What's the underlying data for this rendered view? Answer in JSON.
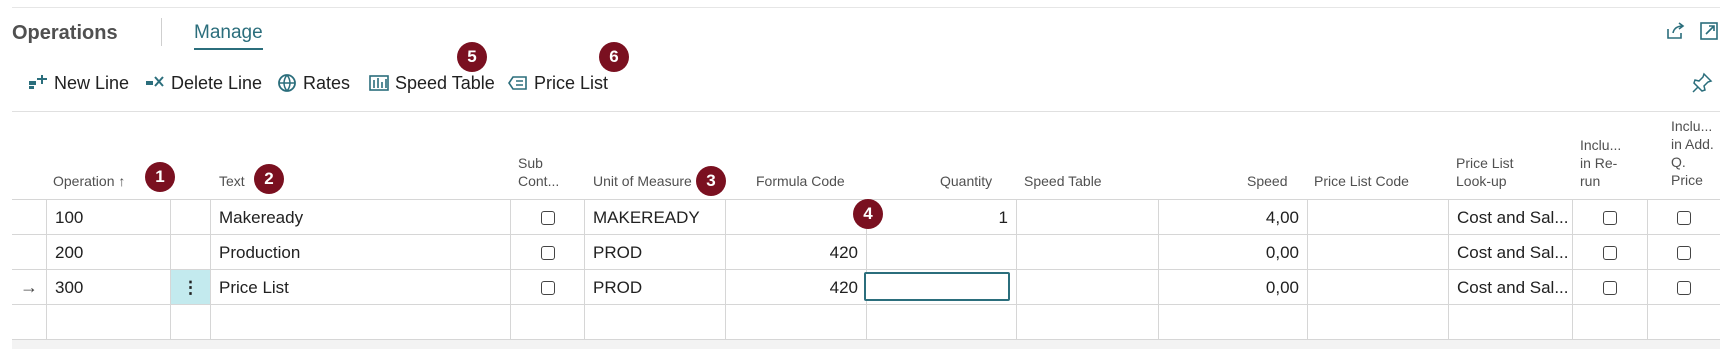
{
  "header": {
    "title": "Operations",
    "tab_manage": "Manage"
  },
  "toolbar": [
    {
      "label": "New Line",
      "icon": "new-line-icon"
    },
    {
      "label": "Delete Line",
      "icon": "delete-line-icon"
    },
    {
      "label": "Rates",
      "icon": "rates-icon"
    },
    {
      "label": "Speed Table",
      "icon": "speed-table-icon"
    },
    {
      "label": "Price List",
      "icon": "price-list-icon"
    }
  ],
  "badges": [
    "1",
    "2",
    "3",
    "4",
    "5",
    "6"
  ],
  "columns": {
    "operation": "Operation ↑",
    "text": "Text",
    "sub_cont": [
      "Sub",
      "Cont..."
    ],
    "uom": "Unit of Measure",
    "formula": "Formula Code",
    "quantity": "Quantity",
    "speed_table": "Speed Table",
    "speed": "Speed",
    "price_list_code": "Price List Code",
    "price_list_lookup": [
      "Price List",
      "Look-up"
    ],
    "incl_rerun": [
      "Inclu...",
      "in Re-",
      "run"
    ],
    "incl_add": [
      "Inclu...",
      "in Add.",
      "Q.",
      "Price"
    ]
  },
  "rows": [
    {
      "operation": "100",
      "text": "Makeready",
      "uom": "MAKEREADY",
      "formula": "",
      "quantity": "1",
      "speed": "4,00",
      "lookup": "Cost and Sal..."
    },
    {
      "operation": "200",
      "text": "Production",
      "uom": "PROD",
      "formula": "420",
      "quantity": "",
      "speed": "0,00",
      "lookup": "Cost and Sal..."
    },
    {
      "operation": "300",
      "text": "Price List",
      "uom": "PROD",
      "formula": "420",
      "quantity": "",
      "speed": "0,00",
      "lookup": "Cost and Sal...",
      "current": true
    }
  ],
  "colors": {
    "accent": "#2b6e7c",
    "badge": "#7a1020"
  }
}
